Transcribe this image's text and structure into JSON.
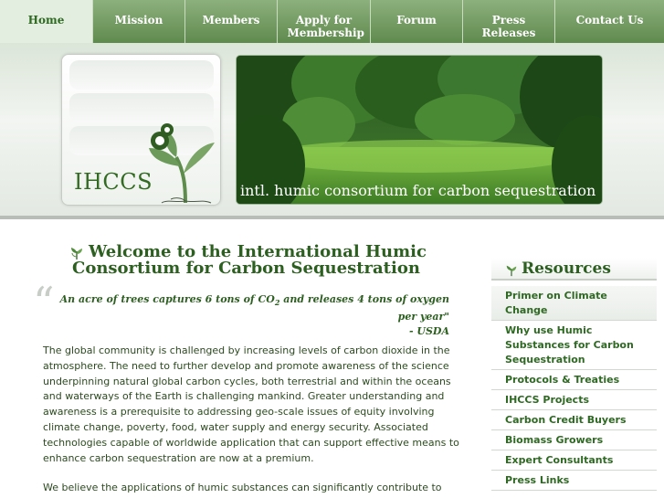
{
  "nav": [
    {
      "label": "Home",
      "active": true
    },
    {
      "label": "Mission"
    },
    {
      "label": "Members"
    },
    {
      "label": "Apply for Membership"
    },
    {
      "label": "Forum"
    },
    {
      "label": "Press Releases"
    },
    {
      "label": "Contact Us"
    }
  ],
  "logo": {
    "text": "IHCCS"
  },
  "banner": {
    "caption": "intl. humic consortium for carbon sequestration"
  },
  "main": {
    "title": "Welcome to the International Humic Consortium for Carbon Sequestration",
    "quote": {
      "part1": "An acre of trees captures 6 tons of CO",
      "sub": "2",
      "part2": " and releases 4 tons of oxygen per year\"",
      "source": "- USDA"
    },
    "paragraphs": [
      "The global community is challenged by increasing levels of carbon dioxide in the atmosphere. The need to further develop and promote awareness of the science underpinning natural global carbon cycles, both terrestrial and within the oceans and waterways of the Earth is challenging mankind. Greater understanding and awareness is a prerequisite to addressing geo-scale issues of equity involving climate change, poverty, food, water supply and energy security. Associated technologies capable of worldwide application that can support effective means to enhance carbon sequestration are now at a premium.",
      "We believe the applications of humic substances can significantly contribute to"
    ]
  },
  "sidebar": {
    "title": "Resources",
    "items": [
      "Primer on Climate Change",
      "Why use Humic Substances for Carbon Sequestration",
      "Protocols & Treaties",
      "IHCCS Projects",
      "Carbon Credit Buyers",
      "Biomass Growers",
      "Expert Consultants",
      "Press Links"
    ]
  },
  "colors": {
    "nav": "#6f9a5e",
    "accent": "#2c5f20",
    "logo": "#326b21"
  }
}
